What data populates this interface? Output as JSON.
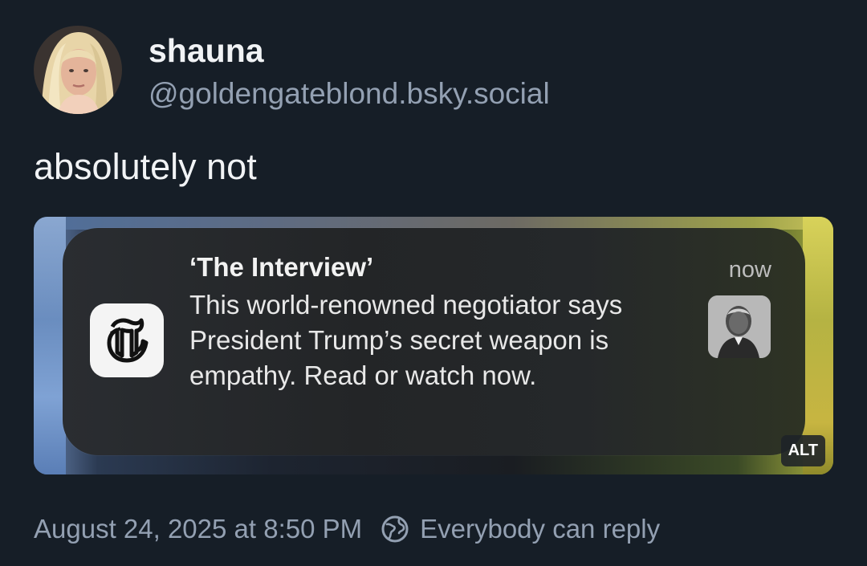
{
  "author": {
    "name": "shauna",
    "handle": "@goldengateblond.bsky.social"
  },
  "post": {
    "text": "absolutely not"
  },
  "embed": {
    "notification": {
      "title": "‘The Interview’",
      "body": "This world-renowned negotiator says President Trump’s secret weapon is empathy. Read or watch now.",
      "time": "now",
      "app_icon": "nyt-logo-icon"
    },
    "alt_badge": "ALT"
  },
  "footer": {
    "timestamp": "August 24, 2025 at 8:50 PM",
    "reply_setting": "Everybody can reply",
    "reply_icon": "globe-icon"
  },
  "colors": {
    "background": "#161e27",
    "text_primary": "#f1f3f5",
    "text_secondary": "#93a0b2"
  }
}
